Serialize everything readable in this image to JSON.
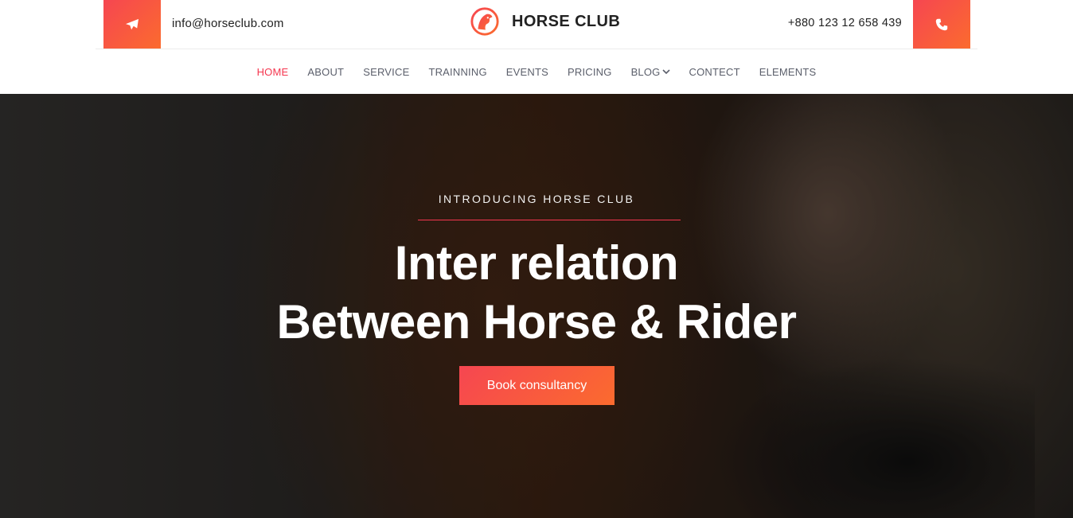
{
  "header": {
    "email": "info@horseclub.com",
    "brand_name": "HORSE CLUB",
    "phone": "+880 123 12 658 439",
    "accent_color": "#f64651"
  },
  "nav": {
    "items": [
      {
        "label": "HOME",
        "active": true
      },
      {
        "label": "ABOUT"
      },
      {
        "label": "SERVICE"
      },
      {
        "label": "TRAINNING"
      },
      {
        "label": "EVENTS"
      },
      {
        "label": "PRICING"
      },
      {
        "label": "BLOG",
        "has_dropdown": true
      },
      {
        "label": "CONTECT"
      },
      {
        "label": "ELEMENTS"
      }
    ]
  },
  "hero": {
    "kicker": "INTRODUCING HORSE CLUB",
    "title_line1": "Inter relation",
    "title_line2": "Between Horse & Rider",
    "cta_label": "Book consultancy"
  },
  "icons": {
    "email": "paper-plane-icon",
    "phone": "phone-icon",
    "logo": "horse-head-logo-icon",
    "dropdown": "chevron-down-icon"
  }
}
